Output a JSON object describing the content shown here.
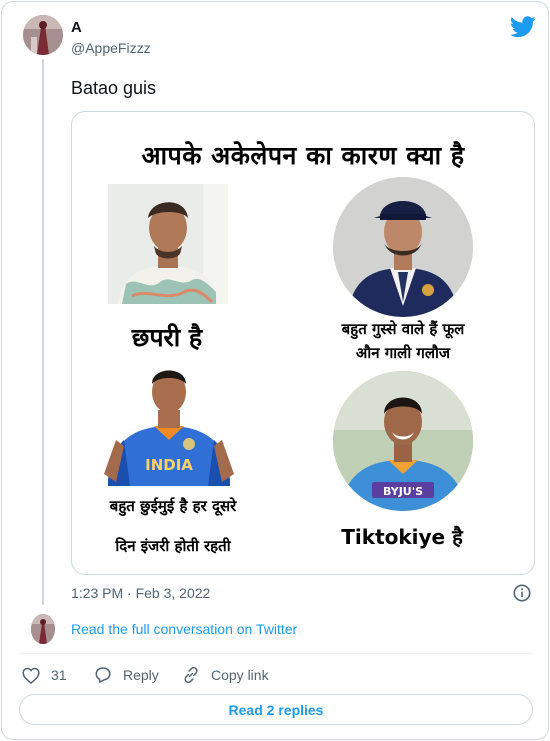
{
  "tweet": {
    "author_name": "A",
    "author_handle": "@AppeFizzz",
    "text": "Batao guis",
    "timestamp": "1:23 PM · Feb 3, 2022",
    "brand_icon": "twitter-bird-icon",
    "accent_color": "#1d9bf0"
  },
  "meme": {
    "title": "आपके अकेलेपन का कारण क्या है",
    "captions": [
      "छपरी है",
      "बहुत गुस्से वाले हैं फूल",
      "औन गाली गलौज",
      "बहुत छुईमुई है हर दूसरे",
      "दिन इंजरी होती रहती",
      "Tiktokiye है"
    ],
    "jersey_text": "INDIA",
    "sponsor_text": "BYJU'S"
  },
  "conversation": {
    "link_label": "Read the full conversation on Twitter"
  },
  "actions": {
    "like_count": "31",
    "reply_label": "Reply",
    "copy_label": "Copy link"
  },
  "footer": {
    "read_replies_label": "Read 2 replies"
  }
}
